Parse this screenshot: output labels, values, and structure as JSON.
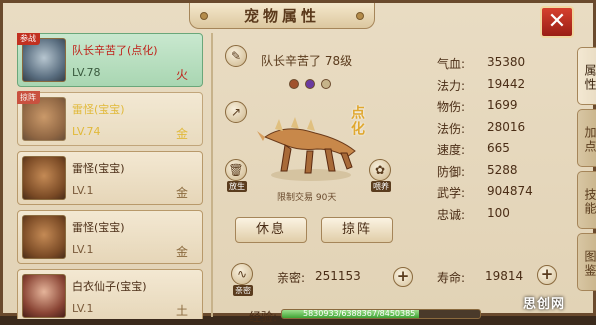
{
  "window": {
    "title": "宠物属性",
    "close_icon": "close-icon"
  },
  "pets": [
    {
      "badge": "参战",
      "name": "队长辛苦了(点化)",
      "level": "LV.78",
      "element": "火",
      "state": "active"
    },
    {
      "badge": "掠阵",
      "name": "雷怪(宝宝)",
      "level": "LV.74",
      "element": "金",
      "state": "dim"
    },
    {
      "badge": "",
      "name": "雷怪(宝宝)",
      "level": "LV.1",
      "element": "金",
      "state": "normal"
    },
    {
      "badge": "",
      "name": "雷怪(宝宝)",
      "level": "LV.1",
      "element": "金",
      "state": "normal"
    },
    {
      "badge": "",
      "name": "白衣仙子(宝宝)",
      "level": "LV.1",
      "element": "土",
      "state": "normal"
    }
  ],
  "detail": {
    "name_level": "队长辛苦了 78级",
    "dian_hua": "点化",
    "restrict_text": "限制交易 90天",
    "release_label": "放生",
    "feed_label": "喂养",
    "rest_button": "休息",
    "lue_zhen_button": "掠阵",
    "intimacy_label": "亲密:",
    "intimacy_value": "251153",
    "intimacy_icon_label": "亲密",
    "exp_label": "经验:",
    "exp_text": "5830933/6388367/8450385",
    "exp_percent": 69
  },
  "stats": [
    {
      "label": "气血:",
      "value": "35380"
    },
    {
      "label": "法力:",
      "value": "19442"
    },
    {
      "label": "物伤:",
      "value": "1699"
    },
    {
      "label": "法伤:",
      "value": "28016"
    },
    {
      "label": "速度:",
      "value": "665"
    },
    {
      "label": "防御:",
      "value": "5288"
    },
    {
      "label": "武学:",
      "value": "904874"
    },
    {
      "label": "忠诚:",
      "value": "100"
    }
  ],
  "life": {
    "label": "寿命:",
    "value": "19814"
  },
  "tabs": [
    "属性",
    "加点",
    "技能",
    "图鉴"
  ],
  "watermark": "思创网"
}
